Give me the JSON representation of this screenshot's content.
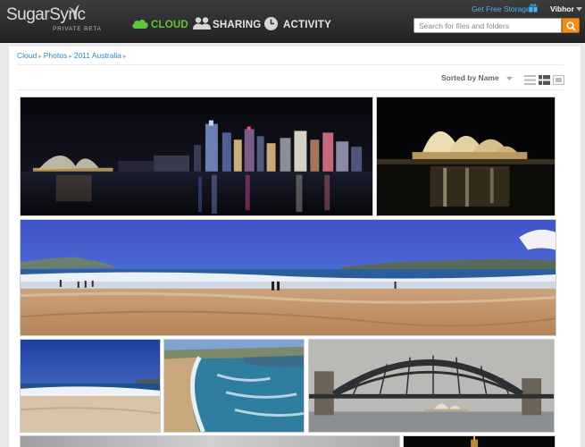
{
  "app": {
    "logo": "SugarSync",
    "logo_tag": "PRIVATE BETA"
  },
  "nav": {
    "items": [
      {
        "label": "CLOUD",
        "icon": "cloud-icon",
        "active": true
      },
      {
        "label": "SHARING",
        "icon": "people-icon",
        "active": false
      },
      {
        "label": "ACTIVITY",
        "icon": "clock-icon",
        "active": false
      }
    ]
  },
  "header": {
    "free_storage": "Get Free Storage",
    "user": "Vibhor",
    "search_placeholder": "Search for files and folders",
    "search_value": ""
  },
  "breadcrumb": [
    {
      "label": "Cloud"
    },
    {
      "label": "Photos"
    },
    {
      "label": "2011 Australia"
    }
  ],
  "toolbar": {
    "sort_label": "Sorted by Name",
    "views": [
      "list-view-icon",
      "detail-view-icon",
      "thumbnail-view-icon"
    ],
    "active_view": "detail-view-icon"
  },
  "colors": {
    "accent_green": "#5ec63f",
    "link_blue": "#2a87c8",
    "search_orange": "#f08d1a",
    "topbar": "#2b2b2b"
  },
  "photos": [
    {
      "id": "p1",
      "subject": "sydney-skyline-night"
    },
    {
      "id": "p2",
      "subject": "opera-house-night"
    },
    {
      "id": "p3",
      "subject": "bondi-beach-panorama"
    },
    {
      "id": "p4",
      "subject": "beach-waves"
    },
    {
      "id": "p5",
      "subject": "coastline-aerial"
    },
    {
      "id": "p6",
      "subject": "harbour-bridge"
    },
    {
      "id": "p7",
      "subject": "grey-sky"
    },
    {
      "id": "p8",
      "subject": "night-tower"
    }
  ]
}
